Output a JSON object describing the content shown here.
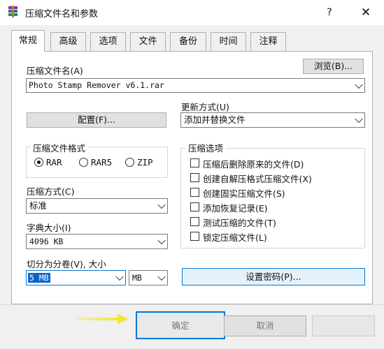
{
  "window": {
    "title": "压缩文件名和参数",
    "help": "?",
    "close": "✕"
  },
  "tabs": [
    {
      "label": "常规",
      "active": true
    },
    {
      "label": "高级"
    },
    {
      "label": "选项"
    },
    {
      "label": "文件"
    },
    {
      "label": "备份"
    },
    {
      "label": "时间"
    },
    {
      "label": "注释"
    }
  ],
  "general": {
    "archive_name_label": "压缩文件名(A)",
    "browse_label": "浏览(B)...",
    "archive_name_value": "Photo Stamp Remover v6.1.rar",
    "profiles_label": "配置(F)...",
    "update_mode_label": "更新方式(U)",
    "update_mode_value": "添加并替换文件",
    "format_group_label": "压缩文件格式",
    "format_options": [
      {
        "label": "RAR",
        "selected": true
      },
      {
        "label": "RAR5",
        "selected": false
      },
      {
        "label": "ZIP",
        "selected": false
      }
    ],
    "method_label": "压缩方式(C)",
    "method_value": "标准",
    "dict_label": "字典大小(I)",
    "dict_value": "4096 KB",
    "split_label": "切分为分卷(V), 大小",
    "split_value": "5 MB",
    "split_unit": "MB",
    "options_group_label": "压缩选项",
    "options": [
      {
        "label": "压缩后删除原来的文件(D)",
        "checked": false
      },
      {
        "label": "创建自解压格式压缩文件(X)",
        "checked": false
      },
      {
        "label": "创建固实压缩文件(S)",
        "checked": false
      },
      {
        "label": "添加恢复记录(E)",
        "checked": false
      },
      {
        "label": "测试压缩的文件(T)",
        "checked": false
      },
      {
        "label": "锁定压缩文件(L)",
        "checked": false
      }
    ],
    "set_password_label": "设置密码(P)..."
  },
  "footer": {
    "ok_label": "确定",
    "cancel_label": "取消"
  },
  "colors": {
    "arrow": "#f2e52a",
    "focus_blue": "#0078d7",
    "selection": "#0a64c8"
  }
}
